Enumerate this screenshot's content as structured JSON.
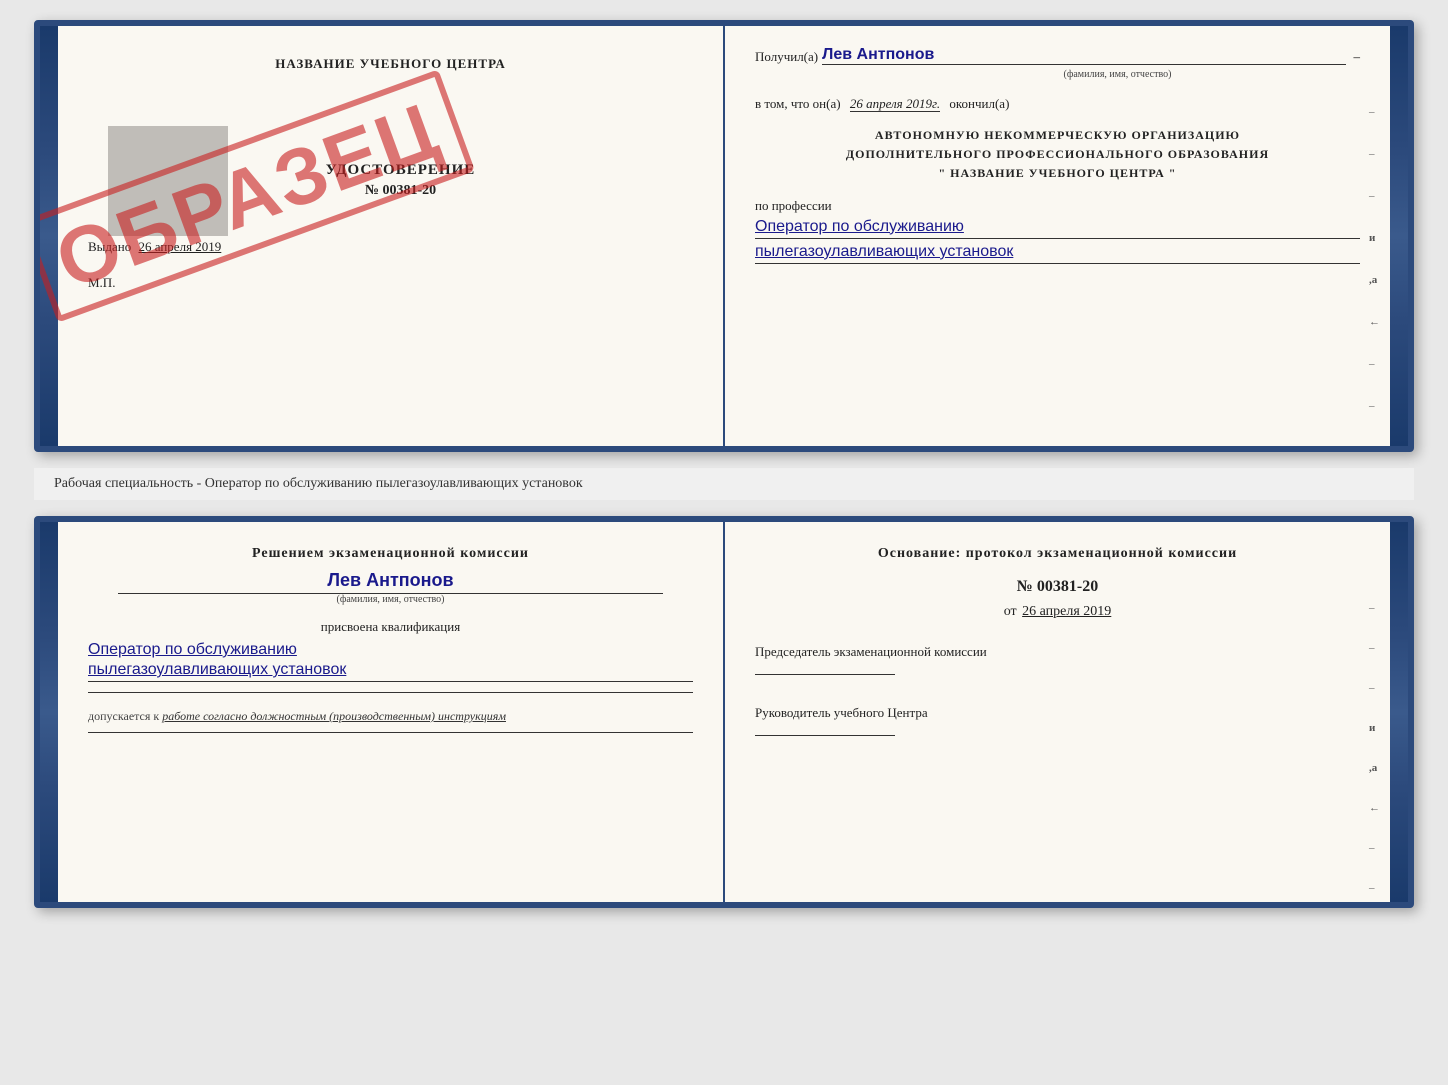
{
  "page": {
    "bg_color": "#e8e8e8"
  },
  "top_book": {
    "left_page": {
      "title": "НАЗВАНИЕ УЧЕБНОГО ЦЕНТРА",
      "cert_type": "УДОСТОВЕРЕНИЕ",
      "cert_number": "№ 00381-20",
      "issued_label": "Выдано",
      "issued_date": "26 апреля 2019",
      "mp_label": "М.П."
    },
    "stamp": {
      "text": "ОБРАЗЕЦ"
    },
    "right_page": {
      "received_label": "Получил(а)",
      "received_name": "Лев Антпонов",
      "fio_hint": "(фамилия, имя, отчество)",
      "completed_prefix": "в том, что он(а)",
      "completed_date": "26 апреля 2019г.",
      "completed_suffix": "окончил(а)",
      "org_line1": "АВТОНОМНУЮ НЕКОММЕРЧЕСКУЮ ОРГАНИЗАЦИЮ",
      "org_line2": "ДОПОЛНИТЕЛЬНОГО ПРОФЕССИОНАЛЬНОГО ОБРАЗОВАНИЯ",
      "org_line3": "\"  НАЗВАНИЕ УЧЕБНОГО ЦЕНТРА  \"",
      "profession_label": "по профессии",
      "profession_line1": "Оператор по обслуживанию",
      "profession_line2": "пылегазоулавливающих установок"
    }
  },
  "subtitle": {
    "text": "Рабочая специальность - Оператор по обслуживанию пылегазоулавливающих установок"
  },
  "bottom_book": {
    "left_page": {
      "decision_text": "Решением экзаменационной комиссии",
      "person_name": "Лев Антпонов",
      "fio_hint": "(фамилия, имя, отчество)",
      "assigned_text": "присвоена квалификация",
      "qual_line1": "Оператор по обслуживанию",
      "qual_line2": "пылегазоулавливающих установок",
      "admitted_label": "допускается к",
      "admitted_value": "работе согласно должностным (производственным) инструкциям"
    },
    "right_page": {
      "basis_text": "Основание: протокол экзаменационной комиссии",
      "protocol_number": "№ 00381-20",
      "date_prefix": "от",
      "date_value": "26 апреля 2019",
      "chair_label": "Председатель экзаменационной комиссии",
      "director_label": "Руководитель учебного Центра"
    }
  },
  "side_marks": {
    "items": [
      "и",
      "а",
      "←",
      "–",
      "–",
      "–",
      "–"
    ]
  }
}
